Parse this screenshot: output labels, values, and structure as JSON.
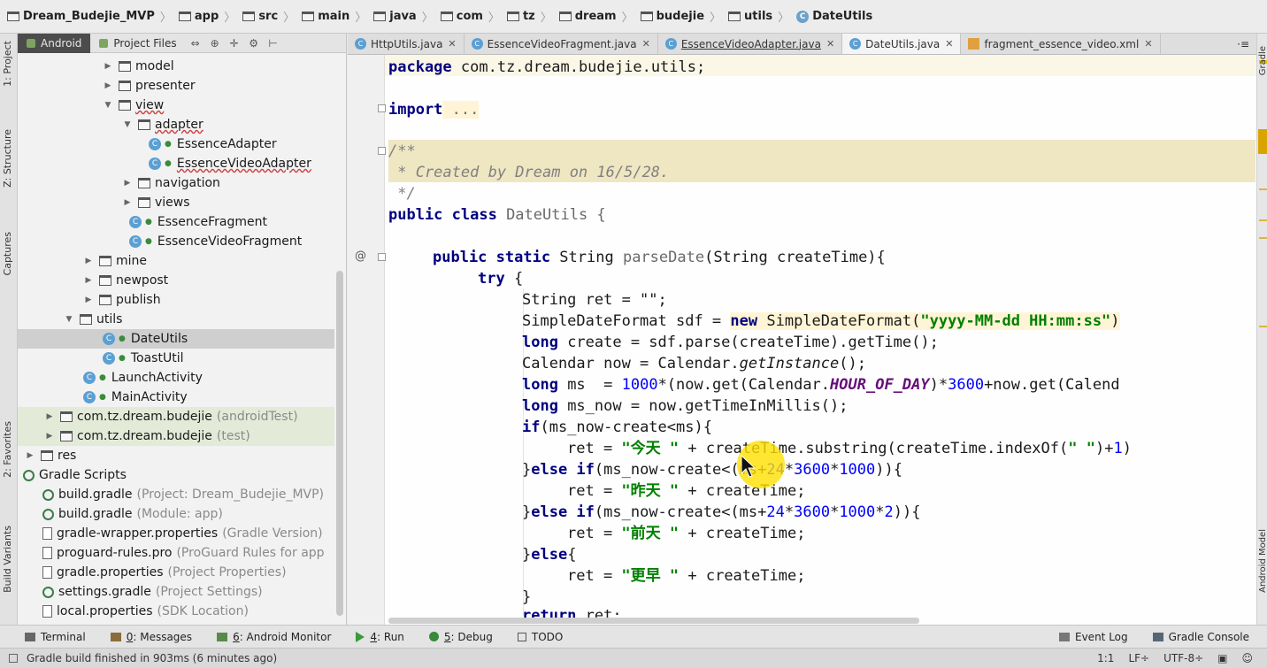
{
  "breadcrumb": [
    "Dream_Budejie_MVP",
    "app",
    "src",
    "main",
    "java",
    "com",
    "tz",
    "dream",
    "budejie",
    "utils",
    "DateUtils"
  ],
  "left_strip": {
    "project": "1: Project",
    "structure": "Z: Structure",
    "captures": "Captures",
    "favorites": "2: Favorites",
    "build_variants": "Build Variants"
  },
  "right_strip": {
    "gradle": "Gradle",
    "android_model": "Android Model"
  },
  "project_header": {
    "android_tab": "Android",
    "files_tab": "Project Files"
  },
  "tree": {
    "model": "model",
    "presenter": "presenter",
    "view": "view",
    "adapter": "adapter",
    "essence_adapter": "EssenceAdapter",
    "essence_video_adapter": "EssenceVideoAdapter",
    "navigation": "navigation",
    "views": "views",
    "essence_fragment": "EssenceFragment",
    "essence_video_fragment": "EssenceVideoFragment",
    "mine": "mine",
    "newpost": "newpost",
    "publish": "publish",
    "utils": "utils",
    "date_utils": "DateUtils",
    "toast_util": "ToastUtil",
    "launch_activity": "LaunchActivity",
    "main_activity": "MainActivity",
    "pkg_android_test": "com.tz.dream.budejie",
    "pkg_android_test_hint": "(androidTest)",
    "pkg_test": "com.tz.dream.budejie",
    "pkg_test_hint": "(test)",
    "res": "res",
    "gradle_scripts": "Gradle Scripts",
    "build_gradle_project": "build.gradle",
    "build_gradle_project_hint": "(Project: Dream_Budejie_MVP)",
    "build_gradle_module": "build.gradle",
    "build_gradle_module_hint": "(Module: app)",
    "gradle_wrapper": "gradle-wrapper.properties",
    "gradle_wrapper_hint": "(Gradle Version)",
    "proguard": "proguard-rules.pro",
    "proguard_hint": "(ProGuard Rules for app",
    "gradle_properties": "gradle.properties",
    "gradle_properties_hint": "(Project Properties)",
    "settings_gradle": "settings.gradle",
    "settings_gradle_hint": "(Project Settings)",
    "local_properties": "local.properties",
    "local_properties_hint": "(SDK Location)"
  },
  "editor_tabs": [
    "HttpUtils.java",
    "EssenceVideoFragment.java",
    "EssenceVideoAdapter.java",
    "DateUtils.java",
    "fragment_essence_video.xml"
  ],
  "code": {
    "l1_kw": "package",
    "l1_rest": " com.tz.dream.budejie.utils;",
    "l2_kw": "import",
    "l2_rest": " ...",
    "l3": "/**",
    "l4": " * Created by Dream on 16/5/28.",
    "l5": " */",
    "l6_kw": "public class",
    "l6_rest": " DateUtils {",
    "l7_kw": "public static",
    "l7_a": " String ",
    "l7_fn": "parseDate",
    "l7_b": "(String createTime){",
    "l8_kw": "try",
    "l8_rest": " {",
    "l9": "String ret = \"\";",
    "l10_a": "SimpleDateFormat sdf = ",
    "l10_kw": "new",
    "l10_b": " SimpleDateFormat(",
    "l10_str": "\"yyyy-MM-dd HH:mm:ss\"",
    "l10_c": ")",
    "l11_kw": "long",
    "l11_rest": " create = sdf.parse(createTime).getTime();",
    "l12_a": "Calendar now = Calendar.",
    "l12_it": "getInstance",
    "l12_b": "();",
    "l13_kw": "long",
    "l13_a": " ms  = ",
    "l13_n1": "1000",
    "l13_b": "*(now.get(Calendar.",
    "l13_fld": "HOUR_OF_DAY",
    "l13_c": ")*",
    "l13_n2": "3600",
    "l13_d": "+now.get(Calend",
    "l14_kw": "long",
    "l14_rest": " ms_now = now.getTimeInMillis();",
    "l15_kw": "if",
    "l15_rest": "(ms_now-create<ms){",
    "l16_a": "ret = ",
    "l16_str": "\"今天 \"",
    "l16_b": " + createTime.substring(createTime.indexOf(",
    "l16_str2": "\" \"",
    "l16_c": ")+",
    "l16_n": "1",
    "l16_d": ")",
    "l17_a": "}",
    "l17_kw": "else if",
    "l17_b": "(ms_now-create<(ms+",
    "l17_n1": "24",
    "l17_c": "*",
    "l17_n2": "3600",
    "l17_d": "*",
    "l17_n3": "1000",
    "l17_e": ")){",
    "l18_a": "ret = ",
    "l18_str": "\"昨天 \"",
    "l18_b": " + createTime;",
    "l19_a": "}",
    "l19_kw": "else if",
    "l19_b": "(ms_now-create<(ms+",
    "l19_n1": "24",
    "l19_c": "*",
    "l19_n2": "3600",
    "l19_d": "*",
    "l19_n3": "1000",
    "l19_e": "*",
    "l19_n4": "2",
    "l19_f": ")){",
    "l20_a": "ret = ",
    "l20_str": "\"前天 \"",
    "l20_b": " + createTime;",
    "l21_a": "}",
    "l21_kw": "else",
    "l21_b": "{",
    "l22_a": "ret = ",
    "l22_str": "\"更早 \"",
    "l22_b": " + createTime;",
    "l23": "}",
    "l24_kw": "return",
    "l24_rest": " ret;"
  },
  "tool_windows": {
    "terminal": "Terminal",
    "messages_key": "0",
    "messages": ": Messages",
    "monitor_key": "6",
    "monitor": ": Android Monitor",
    "run_key": "4",
    "run": ": Run",
    "debug_key": "5",
    "debug": ": Debug",
    "todo": "TODO",
    "event_log": "Event Log",
    "gradle_console": "Gradle Console"
  },
  "status": {
    "message": "Gradle build finished in 903ms (6 minutes ago)",
    "position": "1:1",
    "line_sep": "LF÷",
    "encoding": "UTF-8÷"
  },
  "colors": {
    "keyword": "#000080",
    "string": "#008000",
    "number": "#0000ff",
    "comment": "#808080",
    "field": "#660e7a",
    "cursor_highlight": "#ffe000"
  }
}
